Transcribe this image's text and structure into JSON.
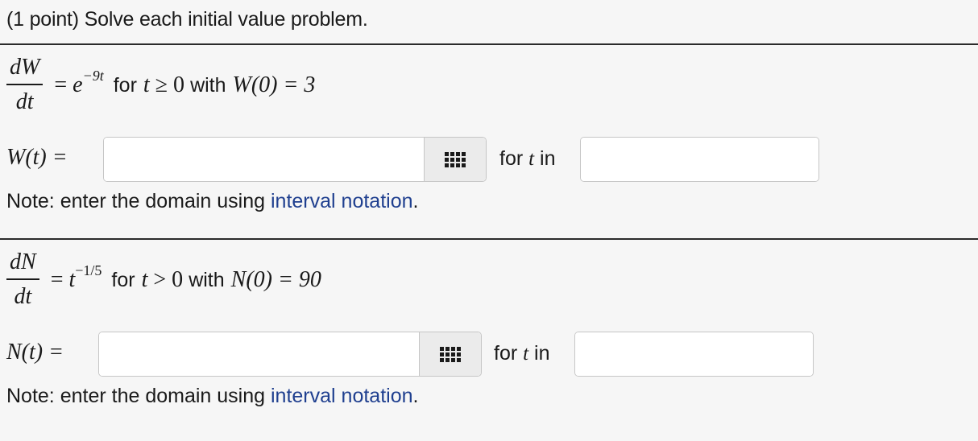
{
  "intro": "(1 point) Solve each initial value problem.",
  "problems": [
    {
      "numerator": "dW",
      "denominator": "dt",
      "rhs_base": "e",
      "rhs_exp": "−9t",
      "for_text": "for",
      "cond_var": "t",
      "cond_rel": " ≥ 0 ",
      "with_text": "with",
      "init_cond": "W(0) = 3",
      "answer_label": "W(t) =",
      "answer_value": "",
      "for_label": "for",
      "for_var": "t",
      "in_label": "in",
      "domain_value": "",
      "note_prefix": "Note: enter the domain using",
      "note_link": "interval notation",
      "note_suffix": "."
    },
    {
      "numerator": "dN",
      "denominator": "dt",
      "rhs_base": "t",
      "rhs_exp": "−1/5",
      "for_text": "for",
      "cond_var": "t",
      "cond_rel": " > 0 ",
      "with_text": "with",
      "init_cond": "N(0) = 90",
      "answer_label": "N(t) =",
      "answer_value": "",
      "for_label": "for",
      "for_var": "t",
      "in_label": "in",
      "domain_value": "",
      "note_prefix": "Note: enter the domain using",
      "note_link": "interval notation",
      "note_suffix": "."
    }
  ]
}
